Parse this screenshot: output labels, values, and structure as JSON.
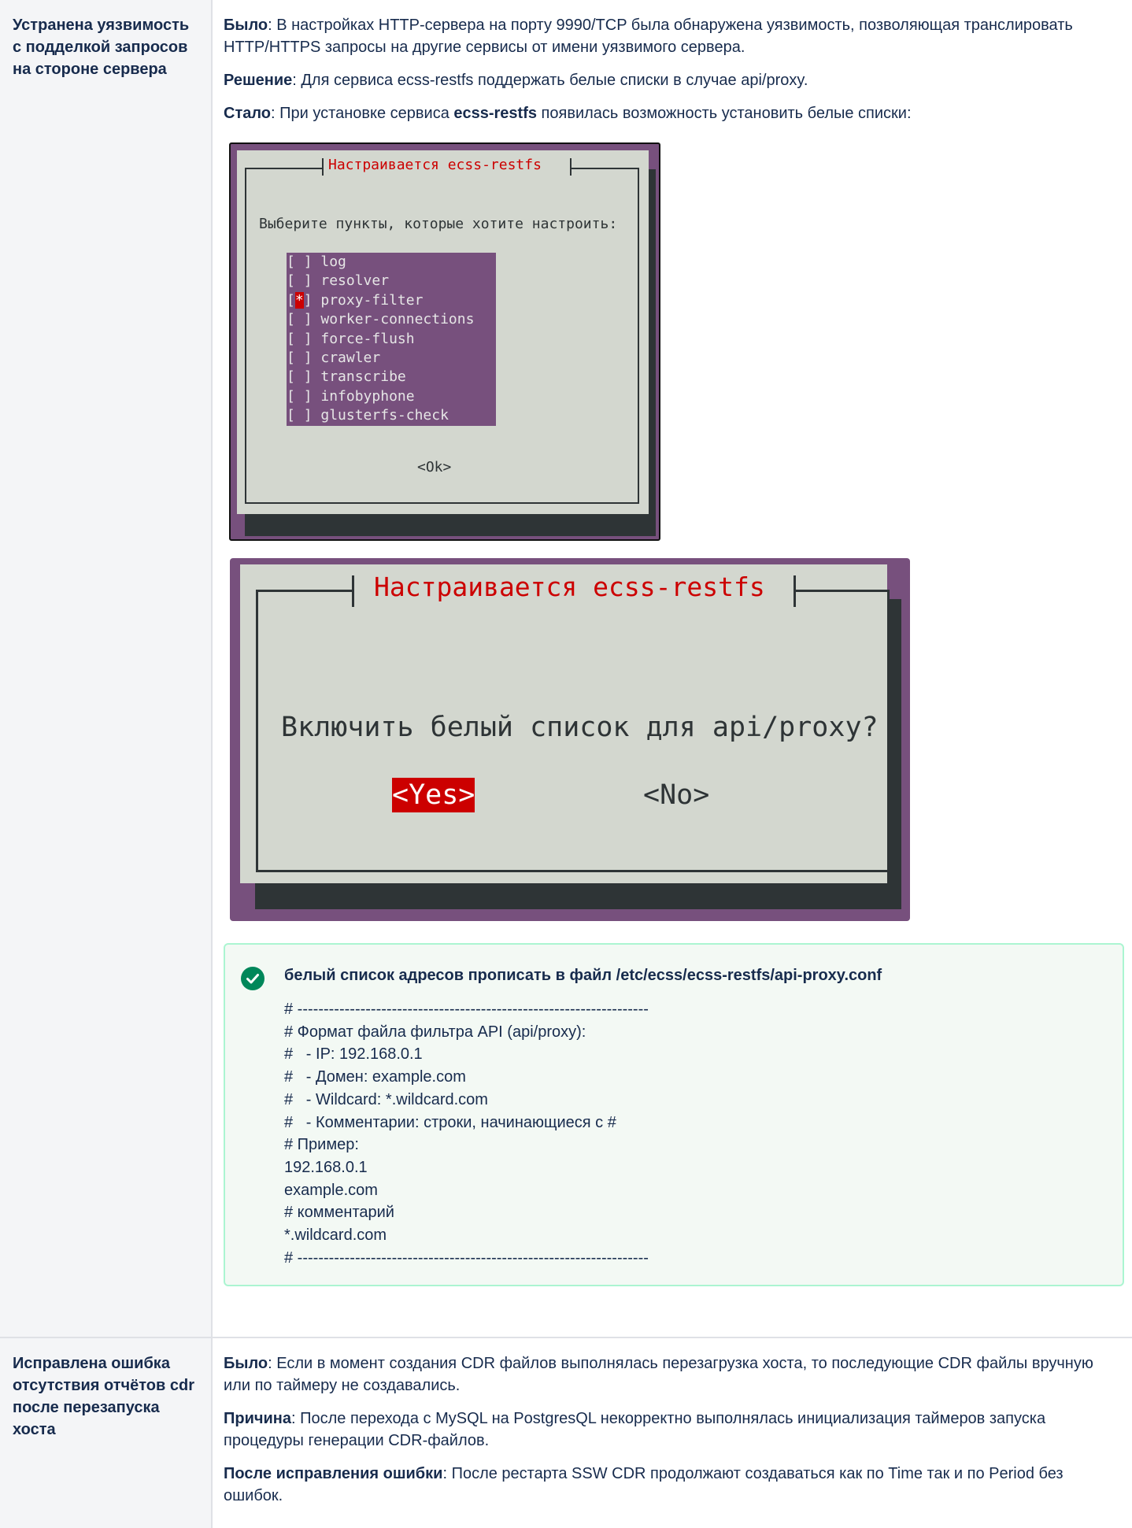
{
  "rows": [
    {
      "heading": "Устранена уязвимость с подделкой запросов на стороне сервера",
      "was_label": "Было",
      "was_text": ": В настройках HTTP-сервера на порту 9990/TCP была обнаружена уязвимость, позволяющая транслировать HTTP/HTTPS запросы на другие сервисы от имени уязвимого сервера.",
      "solution_label": "Решение",
      "solution_text": ": Для сервиса ecss-restfs поддержать белые списки в случае api/proxy.",
      "became_label": "Стало",
      "became_text_1": ": При установке сервиса ",
      "became_bold": "ecss-restfs",
      "became_text_2": " появилась возможность установить белые списки:"
    },
    {
      "heading": "Исправлена ошибка отсутствия отчётов cdr после перезапуска хоста",
      "was_label": "Было",
      "was_text": ": Если в момент создания CDR файлов выполнялась перезагрузка хоста, то последующие CDR файлы вручную или по таймеру не создавались.",
      "cause_label": "Причина",
      "cause_text": ": После перехода с MySQL на PostgresQL некорректно выполнялась инициализация таймеров запуска процедуры генерации CDR-файлов.",
      "fix_label": "После исправления ошибки",
      "fix_text": ": После рестарта SSW CDR продолжают создаваться как по Time так и по Period без ошибок."
    }
  ],
  "terminal1": {
    "title": "Настраивается ecss-restfs",
    "prompt": "Выберите пункты, которые хотите настроить:",
    "items": [
      {
        "label": "log",
        "checked": false
      },
      {
        "label": "resolver",
        "checked": false
      },
      {
        "label": "proxy-filter",
        "checked": true
      },
      {
        "label": "worker-connections",
        "checked": false
      },
      {
        "label": "force-flush",
        "checked": false
      },
      {
        "label": "crawler",
        "checked": false
      },
      {
        "label": "transcribe",
        "checked": false
      },
      {
        "label": "infobyphone",
        "checked": false
      },
      {
        "label": "glusterfs-check",
        "checked": false
      }
    ],
    "ok_button": "<Ok>"
  },
  "terminal2": {
    "title": "Настраивается ecss-restfs",
    "question": "Включить белый список для api/proxy?",
    "yes_button": "<Yes>",
    "no_button": "<No>"
  },
  "note": {
    "title": "белый список адресов прописать в файл /etc/ecss/ecss-restfs/api-proxy.conf",
    "lines": [
      "# -------------------------------------------------------------------",
      "# Формат файла фильтра API (api/proxy):",
      "#   - IP: 192.168.0.1",
      "#   - Домен: example.com",
      "#   - Wildcard: *.wildcard.com",
      "#   - Комментарии: строки, начинающиеся с #",
      "# Пример:",
      "192.168.0.1",
      "example.com",
      "# комментарий",
      "*.wildcard.com",
      "# -------------------------------------------------------------------"
    ]
  },
  "colors": {
    "terminal_purple": "#77507d",
    "terminal_grey": "#d3d7cf",
    "terminal_red": "#cc0000",
    "success_green": "#00875a",
    "panel_bg": "#f3f9f4"
  }
}
